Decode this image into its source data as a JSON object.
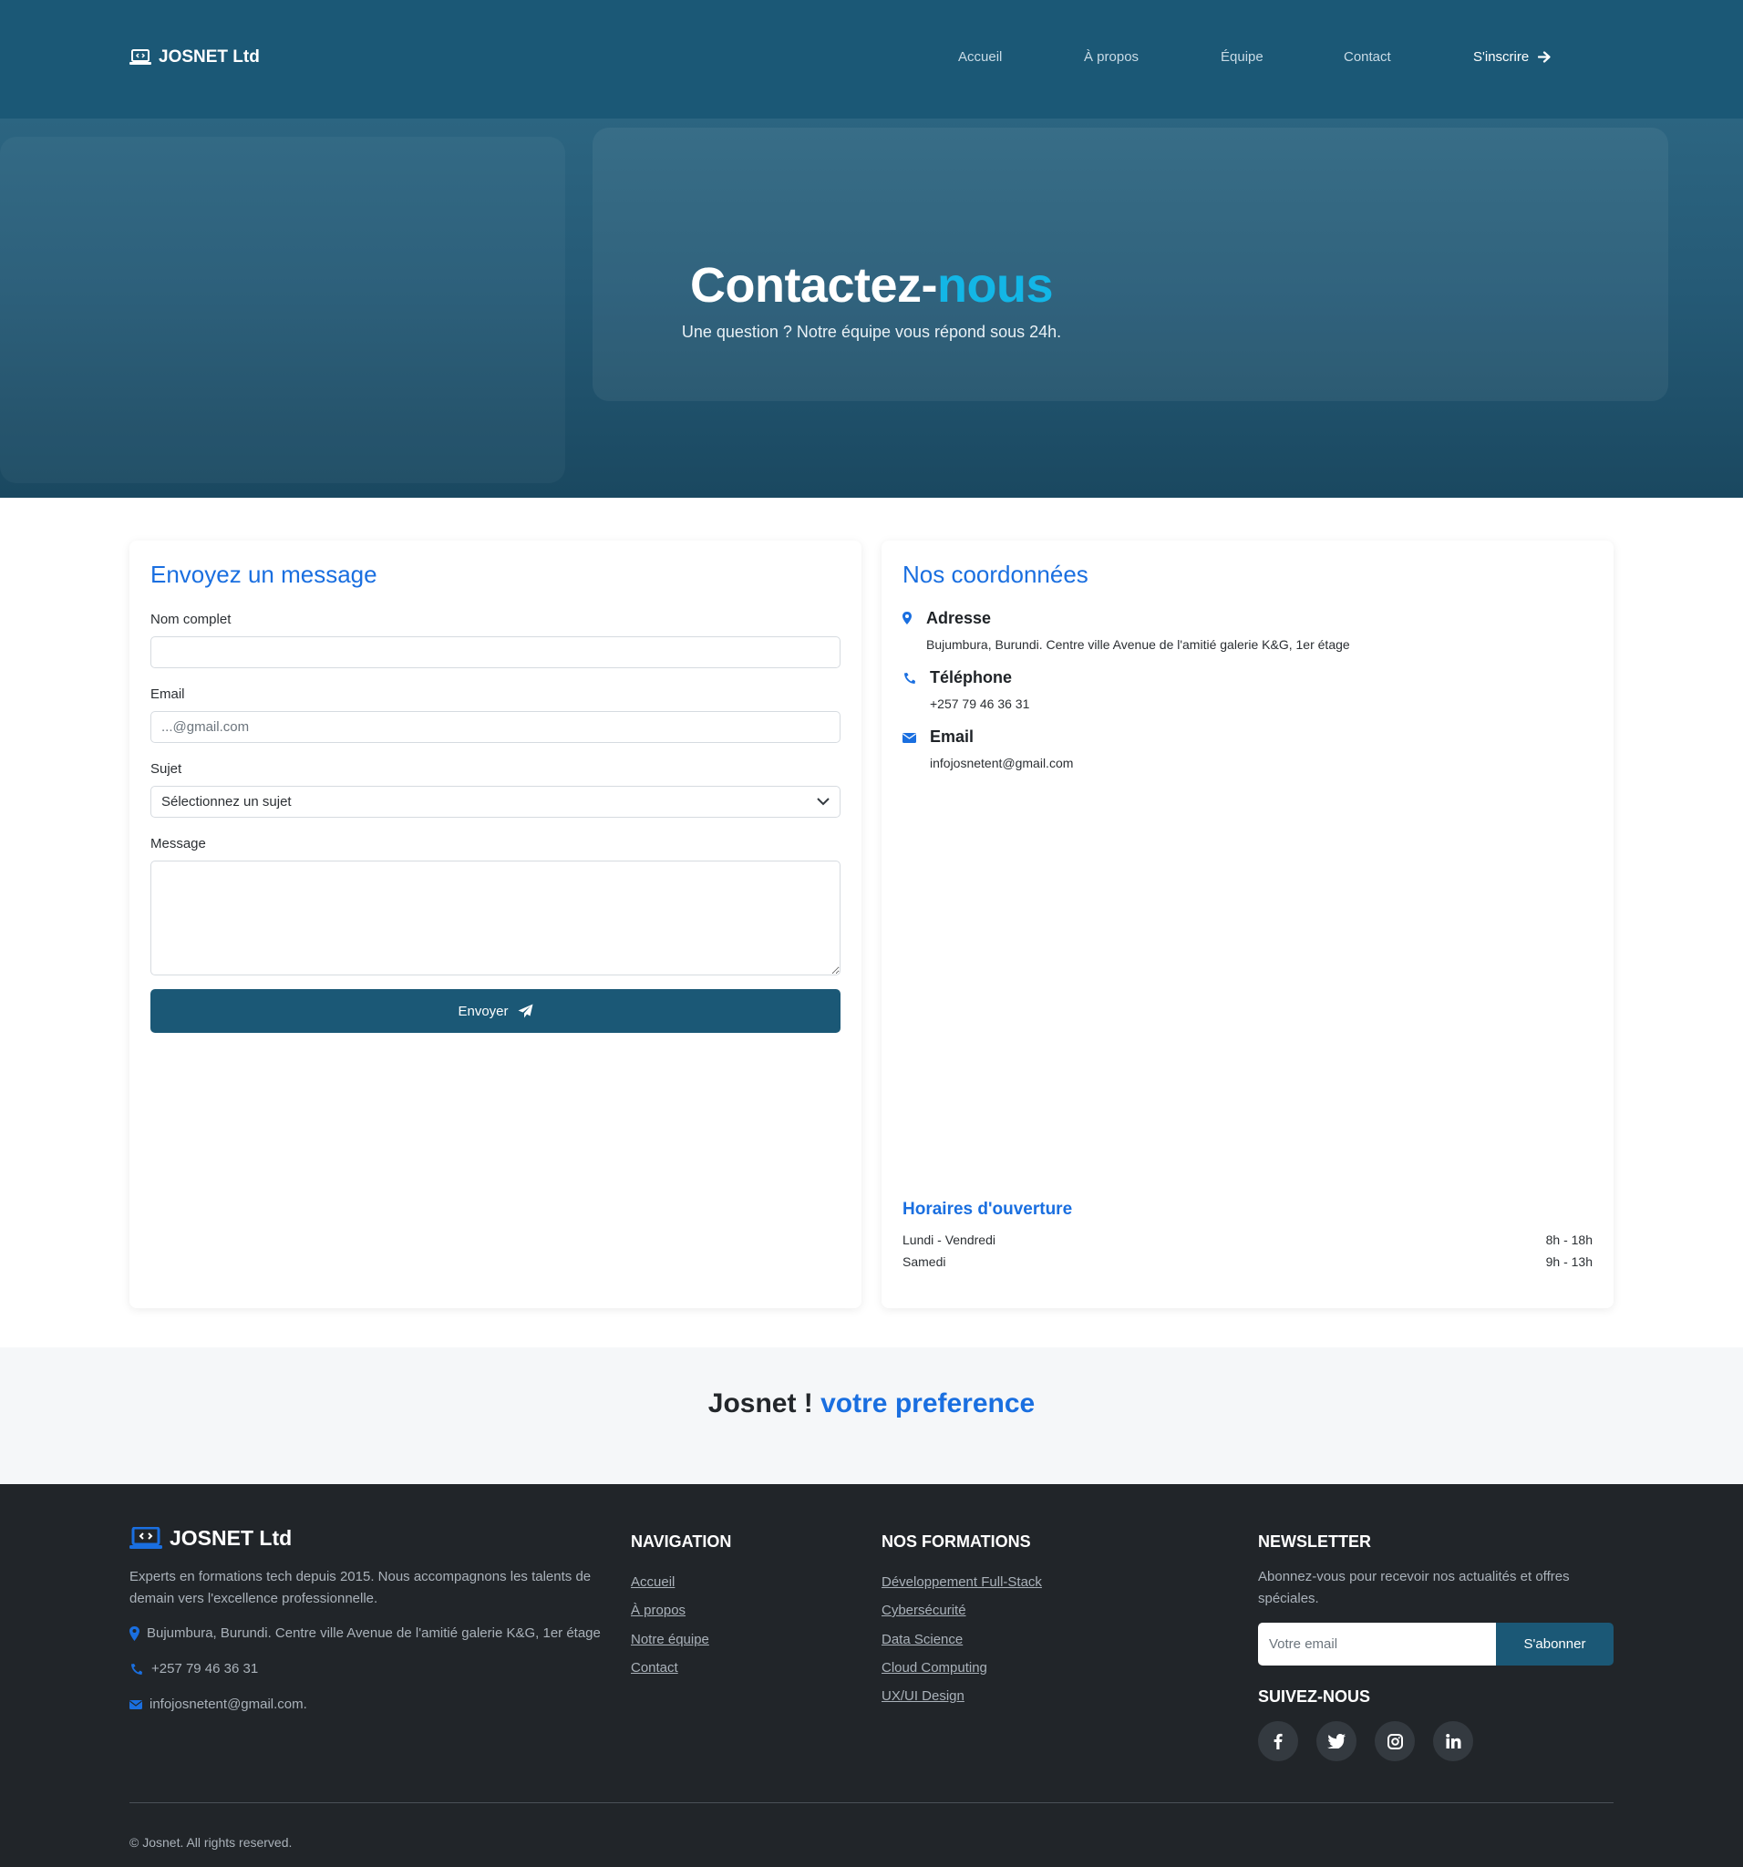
{
  "colors": {
    "primary": "#1b5876",
    "accent_blue": "#1a6fe0",
    "hero_accent": "#13b6e6",
    "footer_bg": "#212529"
  },
  "navbar": {
    "brand": "JOSNET Ltd",
    "brand_icon": "laptop-code-icon",
    "links": [
      "Accueil",
      "À propos",
      "Équipe",
      "Contact"
    ],
    "cta": "S'inscrire",
    "cta_icon": "arrow-right-icon"
  },
  "hero": {
    "title_main": "Contactez-",
    "title_accent": "nous",
    "subtitle": "Une question ? Notre équipe vous répond sous 24h."
  },
  "form": {
    "title": "Envoyez un message",
    "name_label": "Nom complet",
    "name_value": "",
    "email_label": "Email",
    "email_placeholder": "...@gmail.com",
    "subject_label": "Sujet",
    "subject_selected": "Sélectionnez un sujet",
    "message_label": "Message",
    "message_value": "",
    "submit_label": "Envoyer",
    "submit_icon": "paper-plane-icon"
  },
  "contact_info": {
    "title": "Nos coordonnées",
    "address_heading": "Adresse",
    "address": "Bujumbura, Burundi. Centre ville Avenue de l'amitié galerie K&G, 1er étage",
    "phone_heading": "Téléphone",
    "phone": "+257 79 46 36 31",
    "email_heading": "Email",
    "email": "infojosnetent@gmail.com",
    "hours_title": "Horaires d'ouverture",
    "hours": [
      {
        "days": "Lundi - Vendredi",
        "time": "8h - 18h"
      },
      {
        "days": "Samedi",
        "time": "9h - 13h"
      }
    ]
  },
  "tagline": {
    "main": "Josnet ! ",
    "accent": "votre preference"
  },
  "footer": {
    "brand": "JOSNET Ltd",
    "description": "Experts en formations tech depuis 2015. Nous accompagnons les talents de demain vers l'excellence professionnelle.",
    "address": "Bujumbura, Burundi. Centre ville Avenue de l'amitié galerie K&G, 1er étage",
    "phone": "+257 79 46 36 31",
    "email": "infojosnetent@gmail.com.",
    "nav_title": "NAVIGATION",
    "nav_links": [
      "Accueil",
      "À propos",
      "Notre équipe",
      "Contact"
    ],
    "formations_title": "NOS FORMATIONS",
    "formations": [
      "Développement Full-Stack",
      "Cybersécurité",
      "Data Science",
      "Cloud Computing",
      "UX/UI Design"
    ],
    "newsletter_title": "NEWSLETTER",
    "newsletter_text": "Abonnez-vous pour recevoir nos actualités et offres spéciales.",
    "newsletter_placeholder": "Votre email",
    "subscribe_label": "S'abonner",
    "follow_title": "SUIVEZ-NOUS",
    "social_icons": [
      "facebook-icon",
      "twitter-icon",
      "instagram-icon",
      "linkedin-icon"
    ],
    "copyright": "© Josnet. All rights reserved."
  }
}
